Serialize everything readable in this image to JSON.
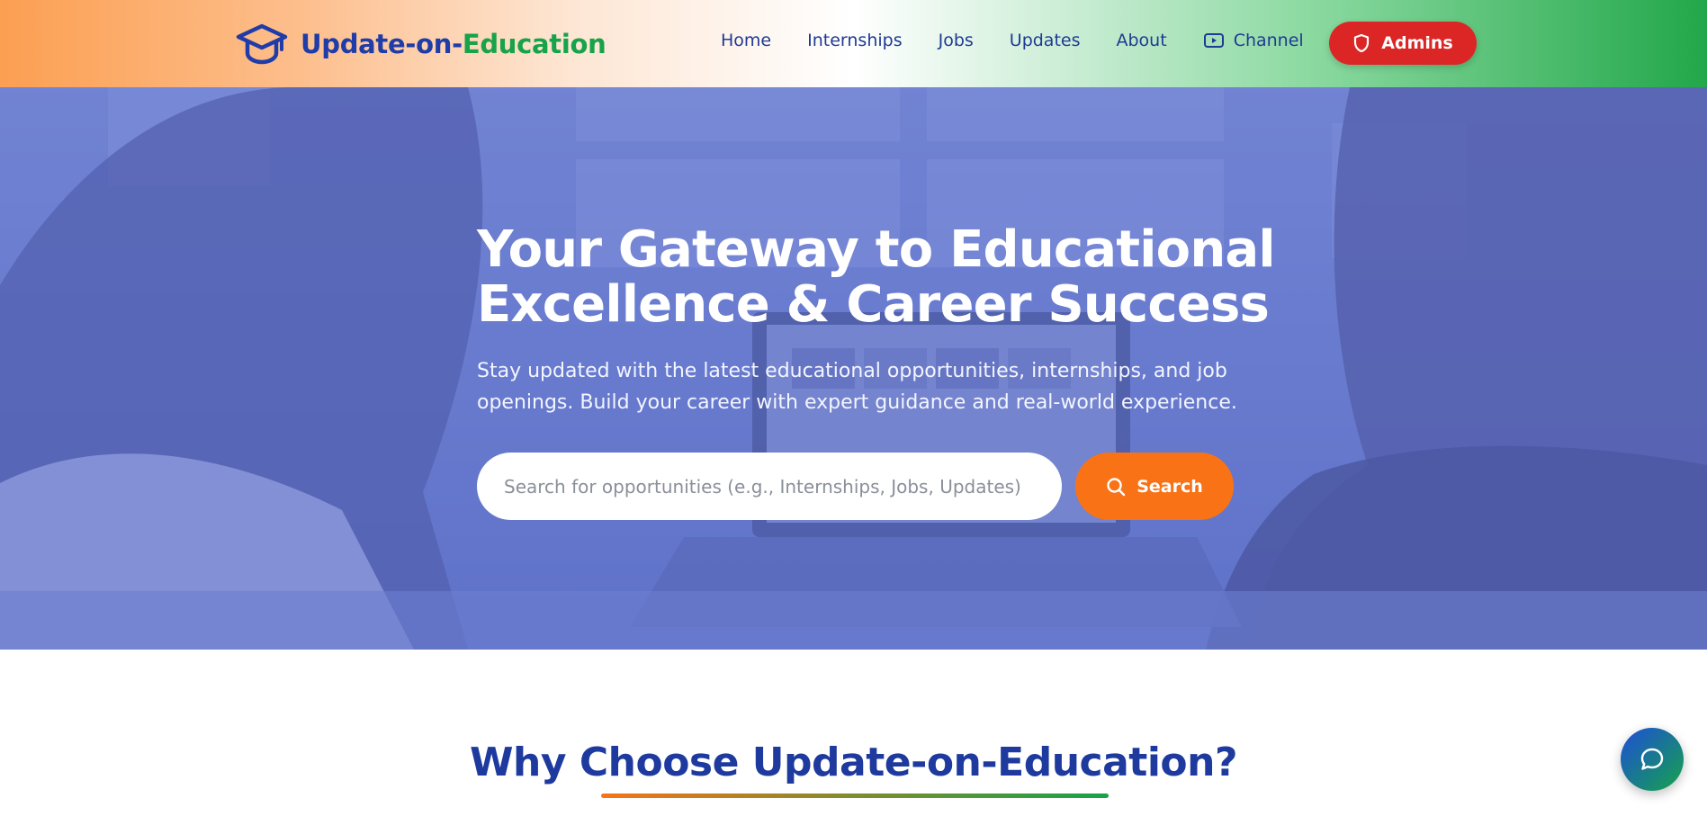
{
  "brand": {
    "name_part1": "Update-on-",
    "name_part2": "Education",
    "icon": "graduation-cap-icon",
    "color_primary": "#1f3ca8",
    "color_accent": "#16a34a"
  },
  "nav": {
    "items": [
      {
        "label": "Home"
      },
      {
        "label": "Internships"
      },
      {
        "label": "Jobs"
      },
      {
        "label": "Updates"
      },
      {
        "label": "About"
      },
      {
        "label": "Channel",
        "icon": "video-play-icon"
      }
    ],
    "admins_label": "Admins",
    "admins_icon": "shield-icon",
    "admins_color": "#dc2626"
  },
  "hero": {
    "title_line1": "Your Gateway to Educational",
    "title_line2": "Excellence & Career Success",
    "subtitle_line1": "Stay updated with the latest educational opportunities, internships, and job",
    "subtitle_line2": "openings. Build your career with expert guidance and real-world experience.",
    "search_placeholder": "Search for opportunities (e.g., Internships, Jobs, Updates)",
    "search_button": "Search",
    "search_button_color": "#f97316"
  },
  "section": {
    "title": "Why Choose Update-on-Education?"
  },
  "chat": {
    "icon": "chat-bubble-icon"
  }
}
